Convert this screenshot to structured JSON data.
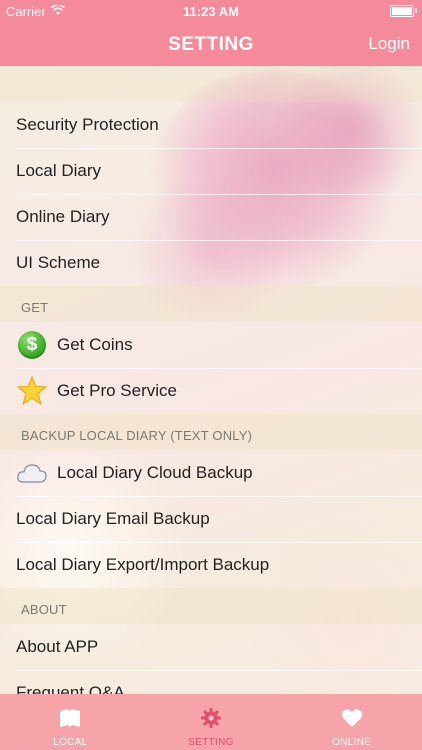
{
  "status_bar": {
    "carrier": "Carrier",
    "time": "11:23 AM",
    "icons": [
      "wifi-icon",
      "battery-icon"
    ]
  },
  "nav": {
    "title": "SETTING",
    "login": "Login"
  },
  "sections": {
    "main": {
      "items": [
        "Security Protection",
        "Local Diary",
        "Online Diary",
        "UI Scheme"
      ]
    },
    "get": {
      "header": "GET",
      "items": [
        {
          "label": "Get Coins",
          "icon": "dollar-coin-icon"
        },
        {
          "label": "Get Pro Service",
          "icon": "star-icon"
        }
      ]
    },
    "backup": {
      "header": "BACKUP LOCAL DIARY (TEXT ONLY)",
      "items": [
        {
          "label": "Local Diary Cloud Backup",
          "icon": "cloud-icon"
        },
        {
          "label": "Local Diary Email Backup"
        },
        {
          "label": "Local Diary Export/Import Backup"
        }
      ]
    },
    "about": {
      "header": "ABOUT",
      "items": [
        "About APP",
        "Frequent Q&A"
      ]
    }
  },
  "tabs": [
    {
      "label": "LOCAL",
      "icon": "book-icon"
    },
    {
      "label": "SETTING",
      "icon": "gear-icon",
      "active": true
    },
    {
      "label": "ONLINE",
      "icon": "heart-icon"
    }
  ],
  "colors": {
    "nav_bg": "#f58a9a",
    "active_tab": "#e0506a"
  }
}
